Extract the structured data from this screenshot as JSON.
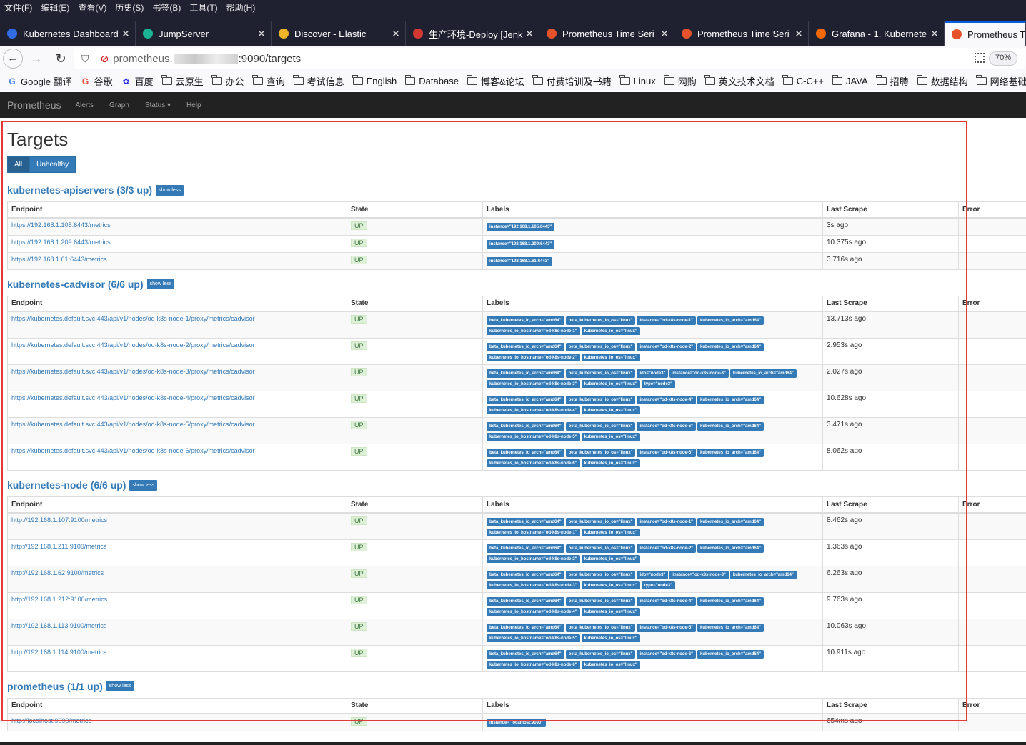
{
  "menubar": [
    "文件(F)",
    "编辑(E)",
    "查看(V)",
    "历史(S)",
    "书签(B)",
    "工具(T)",
    "帮助(H)"
  ],
  "tabs": [
    {
      "title": "Kubernetes Dashboard",
      "color": "#326ce5"
    },
    {
      "title": "JumpServer",
      "color": "#1ab394"
    },
    {
      "title": "Discover - Elastic",
      "color": "#f0b429"
    },
    {
      "title": "生产环境-Deploy [Jenk",
      "color": "#d33833"
    },
    {
      "title": "Prometheus Time Seri",
      "color": "#e6522c"
    },
    {
      "title": "Prometheus Time Seri",
      "color": "#e6522c"
    },
    {
      "title": "Grafana - 1. Kubernete",
      "color": "#f46800"
    },
    {
      "title": "Prometheus Ti",
      "color": "#e6522c"
    }
  ],
  "url": {
    "host_start": "prometheus.",
    "host_end": ":9090/targets"
  },
  "zoom": "70%",
  "bookmarks": [
    "Google 翻译",
    "谷歌",
    "百度",
    "云原生",
    "办公",
    "查询",
    "考试信息",
    "English",
    "Database",
    "博客&论坛",
    "付费培训及书籍",
    "Linux",
    "网购",
    "英文技术文档",
    "C-C++",
    "JAVA",
    "招聘",
    "数据结构",
    "网络基础"
  ],
  "nav": {
    "brand": "Prometheus",
    "links": [
      "Alerts",
      "Graph",
      "Status ▾",
      "Help"
    ]
  },
  "page": {
    "title": "Targets",
    "filters": [
      "All",
      "Unhealthy"
    ],
    "columns": [
      "Endpoint",
      "State",
      "Labels",
      "Last Scrape",
      "Error"
    ]
  },
  "jobs": [
    {
      "title": "kubernetes-apiservers (3/3 up)",
      "toggle": "show less",
      "targets": [
        {
          "endpoint": "https://192.168.1.105:6443/metrics",
          "state": "UP",
          "labels": [
            "instance=\"192.168.1.105:6443\""
          ],
          "last_scrape": "3s ago"
        },
        {
          "endpoint": "https://192.168.1.209:6443/metrics",
          "state": "UP",
          "labels": [
            "instance=\"192.168.1.209:6443\""
          ],
          "last_scrape": "10.375s ago"
        },
        {
          "endpoint": "https://192.168.1.61:6443/metrics",
          "state": "UP",
          "labels": [
            "instance=\"192.168.1.61:6443\""
          ],
          "last_scrape": "3.716s ago"
        }
      ]
    },
    {
      "title": "kubernetes-cadvisor (6/6 up)",
      "toggle": "show less",
      "targets": [
        {
          "endpoint": "https://kubernetes.default.svc:443/api/v1/nodes/od-k8s-node-1/proxy/metrics/cadvisor",
          "state": "UP",
          "labels": [
            "beta_kubernetes_io_arch=\"amd64\"",
            "beta_kubernetes_io_os=\"linux\"",
            "instance=\"od-k8s-node-1\"",
            "kubernetes_io_arch=\"amd64\"",
            "kubernetes_io_hostname=\"od-k8s-node-1\"",
            "kubernetes_io_os=\"linux\""
          ],
          "last_scrape": "13.713s ago"
        },
        {
          "endpoint": "https://kubernetes.default.svc:443/api/v1/nodes/od-k8s-node-2/proxy/metrics/cadvisor",
          "state": "UP",
          "labels": [
            "beta_kubernetes_io_arch=\"amd64\"",
            "beta_kubernetes_io_os=\"linux\"",
            "instance=\"od-k8s-node-2\"",
            "kubernetes_io_arch=\"amd64\"",
            "kubernetes_io_hostname=\"od-k8s-node-2\"",
            "kubernetes_io_os=\"linux\""
          ],
          "last_scrape": "2.953s ago"
        },
        {
          "endpoint": "https://kubernetes.default.svc:443/api/v1/nodes/od-k8s-node-3/proxy/metrics/cadvisor",
          "state": "UP",
          "labels": [
            "beta_kubernetes_io_arch=\"amd64\"",
            "beta_kubernetes_io_os=\"linux\"",
            "ido=\"node3\"",
            "instance=\"od-k8s-node-3\"",
            "kubernetes_io_arch=\"amd64\"",
            "kubernetes_io_hostname=\"od-k8s-node-3\"",
            "kubernetes_io_os=\"linux\"",
            "type=\"node3\""
          ],
          "last_scrape": "2.027s ago"
        },
        {
          "endpoint": "https://kubernetes.default.svc:443/api/v1/nodes/od-k8s-node-4/proxy/metrics/cadvisor",
          "state": "UP",
          "labels": [
            "beta_kubernetes_io_arch=\"amd64\"",
            "beta_kubernetes_io_os=\"linux\"",
            "instance=\"od-k8s-node-4\"",
            "kubernetes_io_arch=\"amd64\"",
            "kubernetes_io_hostname=\"od-k8s-node-4\"",
            "kubernetes_io_os=\"linux\""
          ],
          "last_scrape": "10.628s ago"
        },
        {
          "endpoint": "https://kubernetes.default.svc:443/api/v1/nodes/od-k8s-node-5/proxy/metrics/cadvisor",
          "state": "UP",
          "labels": [
            "beta_kubernetes_io_arch=\"amd64\"",
            "beta_kubernetes_io_os=\"linux\"",
            "instance=\"od-k8s-node-5\"",
            "kubernetes_io_arch=\"amd64\"",
            "kubernetes_io_hostname=\"od-k8s-node-5\"",
            "kubernetes_io_os=\"linux\""
          ],
          "last_scrape": "3.471s ago"
        },
        {
          "endpoint": "https://kubernetes.default.svc:443/api/v1/nodes/od-k8s-node-6/proxy/metrics/cadvisor",
          "state": "UP",
          "labels": [
            "beta_kubernetes_io_arch=\"amd64\"",
            "beta_kubernetes_io_os=\"linux\"",
            "instance=\"od-k8s-node-6\"",
            "kubernetes_io_arch=\"amd64\"",
            "kubernetes_io_hostname=\"od-k8s-node-6\"",
            "kubernetes_io_os=\"linux\""
          ],
          "last_scrape": "8.062s ago"
        }
      ]
    },
    {
      "title": "kubernetes-node (6/6 up)",
      "toggle": "show less",
      "targets": [
        {
          "endpoint": "http://192.168.1.107:9100/metrics",
          "state": "UP",
          "labels": [
            "beta_kubernetes_io_arch=\"amd64\"",
            "beta_kubernetes_io_os=\"linux\"",
            "instance=\"od-k8s-node-1\"",
            "kubernetes_io_arch=\"amd64\"",
            "kubernetes_io_hostname=\"od-k8s-node-1\"",
            "kubernetes_io_os=\"linux\""
          ],
          "last_scrape": "8.462s ago"
        },
        {
          "endpoint": "http://192.168.1.211:9100/metrics",
          "state": "UP",
          "labels": [
            "beta_kubernetes_io_arch=\"amd64\"",
            "beta_kubernetes_io_os=\"linux\"",
            "instance=\"od-k8s-node-2\"",
            "kubernetes_io_arch=\"amd64\"",
            "kubernetes_io_hostname=\"od-k8s-node-2\"",
            "kubernetes_io_os=\"linux\""
          ],
          "last_scrape": "1.363s ago"
        },
        {
          "endpoint": "http://192.168.1.62:9100/metrics",
          "state": "UP",
          "labels": [
            "beta_kubernetes_io_arch=\"amd64\"",
            "beta_kubernetes_io_os=\"linux\"",
            "ido=\"node3\"",
            "instance=\"od-k8s-node-3\"",
            "kubernetes_io_arch=\"amd64\"",
            "kubernetes_io_hostname=\"od-k8s-node-3\"",
            "kubernetes_io_os=\"linux\"",
            "type=\"node3\""
          ],
          "last_scrape": "6.263s ago"
        },
        {
          "endpoint": "http://192.168.1.212:9100/metrics",
          "state": "UP",
          "labels": [
            "beta_kubernetes_io_arch=\"amd64\"",
            "beta_kubernetes_io_os=\"linux\"",
            "instance=\"od-k8s-node-4\"",
            "kubernetes_io_arch=\"amd64\"",
            "kubernetes_io_hostname=\"od-k8s-node-4\"",
            "kubernetes_io_os=\"linux\""
          ],
          "last_scrape": "9.763s ago"
        },
        {
          "endpoint": "http://192.168.1.113:9100/metrics",
          "state": "UP",
          "labels": [
            "beta_kubernetes_io_arch=\"amd64\"",
            "beta_kubernetes_io_os=\"linux\"",
            "instance=\"od-k8s-node-5\"",
            "kubernetes_io_arch=\"amd64\"",
            "kubernetes_io_hostname=\"od-k8s-node-5\"",
            "kubernetes_io_os=\"linux\""
          ],
          "last_scrape": "10.063s ago"
        },
        {
          "endpoint": "http://192.168.1.114:9100/metrics",
          "state": "UP",
          "labels": [
            "beta_kubernetes_io_arch=\"amd64\"",
            "beta_kubernetes_io_os=\"linux\"",
            "instance=\"od-k8s-node-6\"",
            "kubernetes_io_arch=\"amd64\"",
            "kubernetes_io_hostname=\"od-k8s-node-6\"",
            "kubernetes_io_os=\"linux\""
          ],
          "last_scrape": "10.911s ago"
        }
      ]
    },
    {
      "title": "prometheus (1/1 up)",
      "toggle": "show less",
      "targets": [
        {
          "endpoint": "http://localhost:9090/metrics",
          "state": "UP",
          "labels": [
            "instance=\"localhost:9090\""
          ],
          "last_scrape": "654ms ago"
        }
      ]
    }
  ]
}
